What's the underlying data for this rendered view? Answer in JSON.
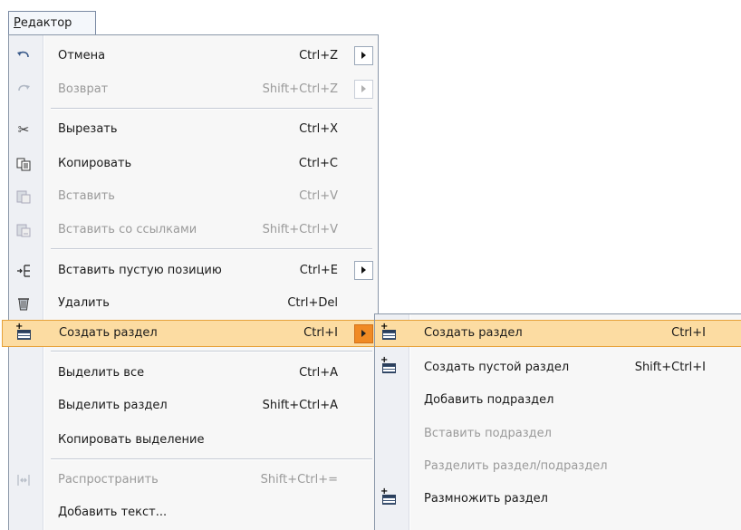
{
  "menubar": {
    "title_first": "Р",
    "title_rest": "едактор"
  },
  "main_menu": {
    "items": [
      {
        "label": "Отмена",
        "shortcut": "Ctrl+Z",
        "icon": "undo-icon",
        "submenu": true,
        "disabled": false
      },
      {
        "label": "Возврат",
        "shortcut": "Shift+Ctrl+Z",
        "icon": "redo-icon",
        "submenu": true,
        "disabled": true
      },
      {
        "label": "Вырезать",
        "shortcut": "Ctrl+X",
        "icon": "scissors-icon",
        "disabled": false
      },
      {
        "label": "Копировать",
        "shortcut": "Ctrl+C",
        "icon": "copy-icon",
        "disabled": false
      },
      {
        "label": "Вставить",
        "shortcut": "Ctrl+V",
        "icon": "paste-icon",
        "disabled": true
      },
      {
        "label": "Вставить со ссылками",
        "shortcut": "Shift+Ctrl+V",
        "icon": "paste-link-icon",
        "disabled": true
      },
      {
        "label": "Вставить пустую позицию",
        "shortcut": "Ctrl+E",
        "icon": "insert-position-icon",
        "submenu": true,
        "disabled": false
      },
      {
        "label": "Удалить",
        "shortcut": "Ctrl+Del",
        "icon": "delete-icon",
        "disabled": false
      },
      {
        "label": "Создать раздел",
        "shortcut": "Ctrl+I",
        "icon": "create-section-icon",
        "submenu": true,
        "highlighted": true
      },
      {
        "label": "Выделить все",
        "shortcut": "Ctrl+A"
      },
      {
        "label": "Выделить раздел",
        "shortcut": "Shift+Ctrl+A"
      },
      {
        "label": "Копировать выделение",
        "shortcut": ""
      },
      {
        "label": "Распространить",
        "shortcut": "Shift+Ctrl+=",
        "icon": "spread-icon",
        "disabled": true
      },
      {
        "label": "Добавить текст...",
        "shortcut": ""
      }
    ]
  },
  "sub_menu": {
    "items": [
      {
        "label": "Создать раздел",
        "shortcut": "Ctrl+I",
        "icon": "create-section-icon",
        "highlighted": true
      },
      {
        "label": "Создать пустой раздел",
        "shortcut": "Shift+Ctrl+I",
        "icon": "create-empty-section-icon"
      },
      {
        "label": "Добавить подраздел",
        "shortcut": ""
      },
      {
        "label": "Вставить подраздел",
        "shortcut": "",
        "disabled": true
      },
      {
        "label": "Разделить раздел/подраздел",
        "shortcut": "",
        "disabled": true
      },
      {
        "label": "Размножить раздел",
        "shortcut": "",
        "icon": "multiply-section-icon"
      }
    ]
  }
}
